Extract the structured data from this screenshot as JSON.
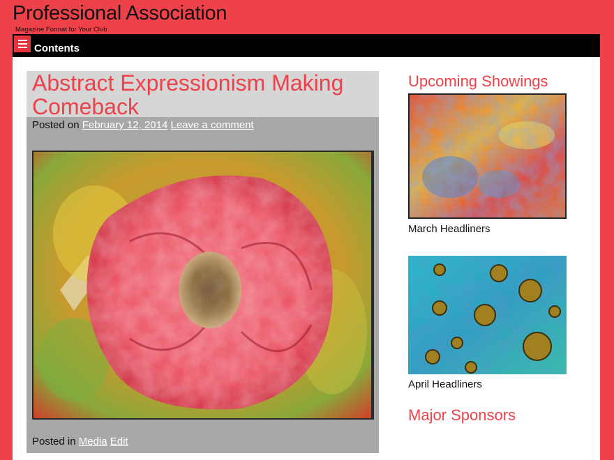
{
  "site": {
    "title": "Professional Association",
    "description": "Magazine Format for Your Club"
  },
  "nav": {
    "label": "Contents"
  },
  "post": {
    "title": "Abstract Expressionism Making Comeback",
    "posted_on": "Posted on",
    "date": "February 12, 2014",
    "comment_link": "Leave a comment",
    "posted_in": "Posted in",
    "category": "Media",
    "edit_link": "Edit"
  },
  "sidebar": {
    "upcoming_title": "Upcoming Showings",
    "showings": [
      {
        "caption": "March Headliners"
      },
      {
        "caption": "April Headliners"
      }
    ],
    "sponsors_title": "Major Sponsors"
  },
  "colors": {
    "background": "#ee4149",
    "accent": "#ee4149",
    "navbar": "#000000"
  }
}
